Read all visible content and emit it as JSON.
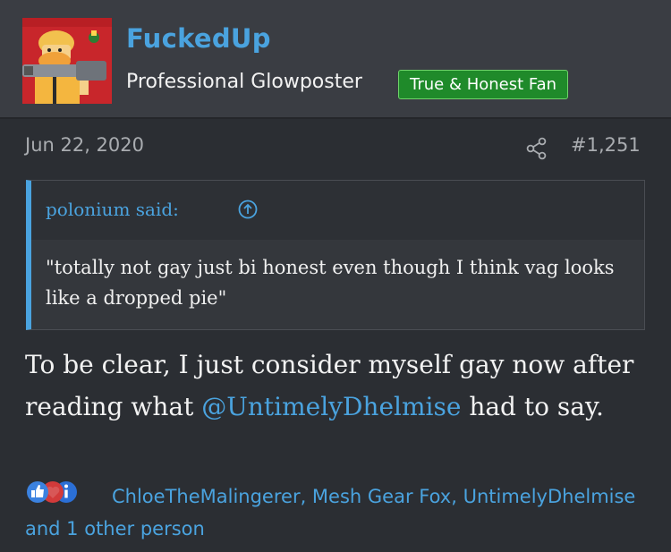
{
  "user": {
    "name": "FuckedUp",
    "title": "Professional Glowposter",
    "badge": "True & Honest Fan"
  },
  "post": {
    "date": "Jun 22, 2020",
    "number": "#1,251",
    "text_before": "To be clear, I just consider myself gay now after reading what ",
    "mention": "@UntimelyDhelmise",
    "text_after": " had to say."
  },
  "quote": {
    "author": "polonium said:",
    "body": "\"totally not gay just bi honest even though I think vag looks like a dropped pie\""
  },
  "reactions": {
    "icons": [
      "like-icon",
      "love-icon",
      "info-icon"
    ],
    "names": "ChloeTheMalingerer, Mesh Gear Fox, UntimelyDhelmise and 1 other person"
  },
  "colors": {
    "link": "#4aa3df",
    "badge_bg": "#1f8a2a",
    "background": "#2b2e33",
    "header_bg": "#3a3d43"
  }
}
